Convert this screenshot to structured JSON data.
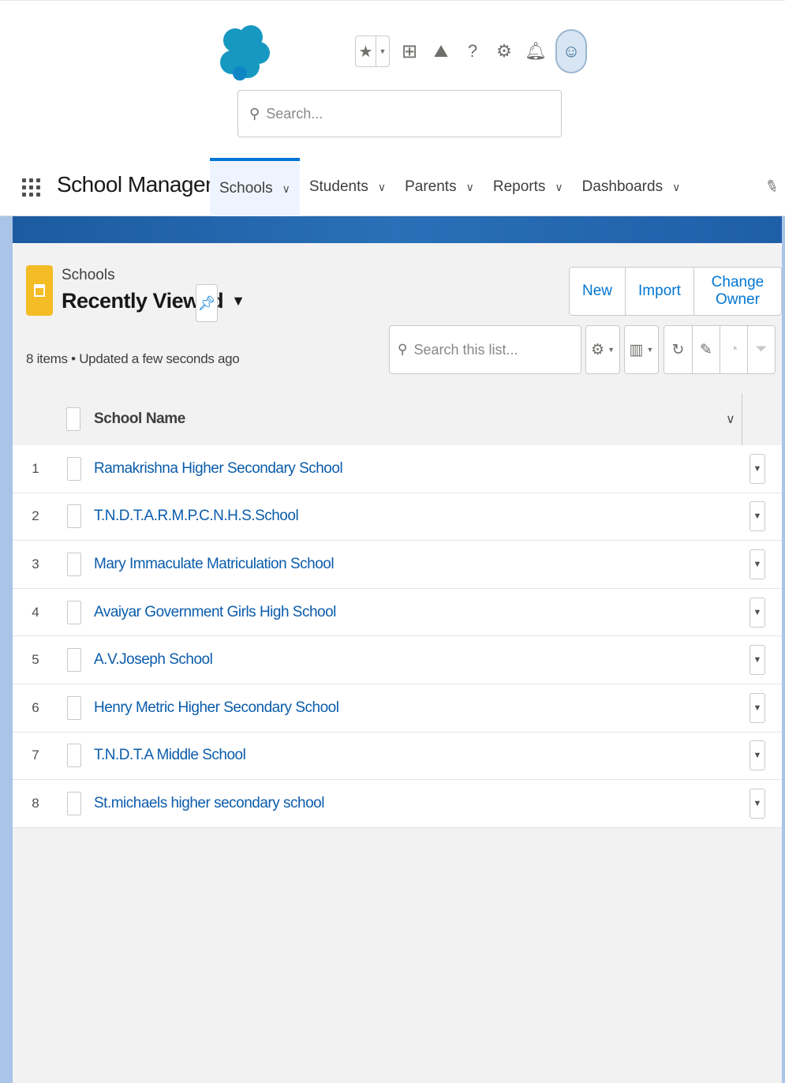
{
  "header": {
    "search_placeholder": "Search...",
    "utility_icons": [
      "favorites-star-icon",
      "add-icon",
      "trailhead-icon",
      "help-icon",
      "setup-gear-icon",
      "notifications-bell-icon",
      "user-avatar"
    ]
  },
  "app_nav": {
    "app_name": "School Management",
    "tabs": [
      {
        "label": "Schools",
        "active": true
      },
      {
        "label": "Students",
        "active": false
      },
      {
        "label": "Parents",
        "active": false
      },
      {
        "label": "Reports",
        "active": false
      },
      {
        "label": "Dashboards",
        "active": false
      }
    ]
  },
  "list_view": {
    "object_label": "Schools",
    "view_name": "Recently Viewed",
    "meta": "8 items • Updated a few seconds ago",
    "search_placeholder": "Search this list...",
    "buttons": {
      "new": "New",
      "import": "Import",
      "change_owner": "Change Owner"
    },
    "column_header": "School Name",
    "rows": [
      {
        "num": "1",
        "name": "Ramakrishna Higher Secondary School"
      },
      {
        "num": "2",
        "name": "T.N.D.T.A.R.M.P.C.N.H.S.School"
      },
      {
        "num": "3",
        "name": "Mary Immaculate Matriculation School"
      },
      {
        "num": "4",
        "name": "Avaiyar Government Girls High School"
      },
      {
        "num": "5",
        "name": "A.V.Joseph School"
      },
      {
        "num": "6",
        "name": "Henry Metric Higher Secondary School"
      },
      {
        "num": "7",
        "name": "T.N.D.T.A Middle School"
      },
      {
        "num": "8",
        "name": "St.michaels higher secondary school"
      }
    ]
  },
  "colors": {
    "brand_blue": "#0176d3",
    "link_blue": "#0b5cab",
    "object_icon_yellow": "#f4bc25",
    "band_blue": "#2a6fb7"
  }
}
